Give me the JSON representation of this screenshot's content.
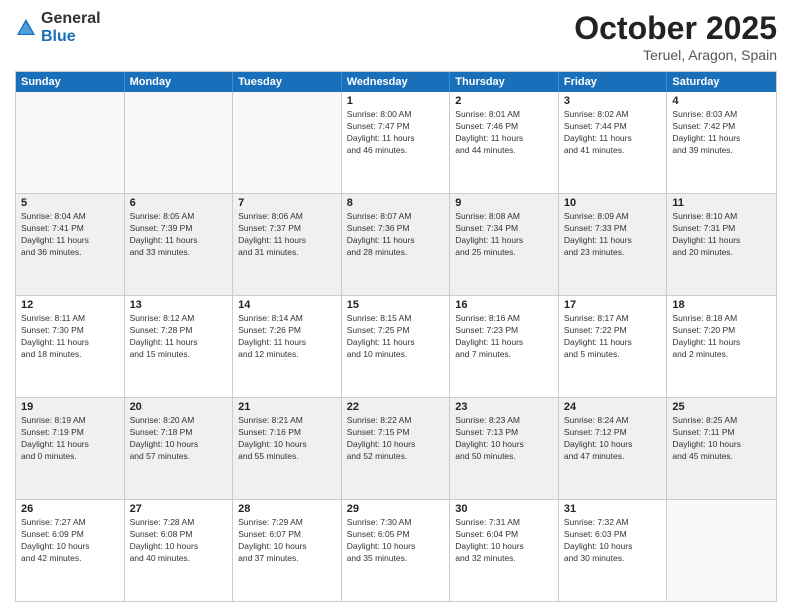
{
  "logo": {
    "general": "General",
    "blue": "Blue"
  },
  "title": "October 2025",
  "location": "Teruel, Aragon, Spain",
  "header_days": [
    "Sunday",
    "Monday",
    "Tuesday",
    "Wednesday",
    "Thursday",
    "Friday",
    "Saturday"
  ],
  "rows": [
    [
      {
        "day": "",
        "lines": []
      },
      {
        "day": "",
        "lines": []
      },
      {
        "day": "",
        "lines": []
      },
      {
        "day": "1",
        "lines": [
          "Sunrise: 8:00 AM",
          "Sunset: 7:47 PM",
          "Daylight: 11 hours",
          "and 46 minutes."
        ]
      },
      {
        "day": "2",
        "lines": [
          "Sunrise: 8:01 AM",
          "Sunset: 7:46 PM",
          "Daylight: 11 hours",
          "and 44 minutes."
        ]
      },
      {
        "day": "3",
        "lines": [
          "Sunrise: 8:02 AM",
          "Sunset: 7:44 PM",
          "Daylight: 11 hours",
          "and 41 minutes."
        ]
      },
      {
        "day": "4",
        "lines": [
          "Sunrise: 8:03 AM",
          "Sunset: 7:42 PM",
          "Daylight: 11 hours",
          "and 39 minutes."
        ]
      }
    ],
    [
      {
        "day": "5",
        "lines": [
          "Sunrise: 8:04 AM",
          "Sunset: 7:41 PM",
          "Daylight: 11 hours",
          "and 36 minutes."
        ]
      },
      {
        "day": "6",
        "lines": [
          "Sunrise: 8:05 AM",
          "Sunset: 7:39 PM",
          "Daylight: 11 hours",
          "and 33 minutes."
        ]
      },
      {
        "day": "7",
        "lines": [
          "Sunrise: 8:06 AM",
          "Sunset: 7:37 PM",
          "Daylight: 11 hours",
          "and 31 minutes."
        ]
      },
      {
        "day": "8",
        "lines": [
          "Sunrise: 8:07 AM",
          "Sunset: 7:36 PM",
          "Daylight: 11 hours",
          "and 28 minutes."
        ]
      },
      {
        "day": "9",
        "lines": [
          "Sunrise: 8:08 AM",
          "Sunset: 7:34 PM",
          "Daylight: 11 hours",
          "and 25 minutes."
        ]
      },
      {
        "day": "10",
        "lines": [
          "Sunrise: 8:09 AM",
          "Sunset: 7:33 PM",
          "Daylight: 11 hours",
          "and 23 minutes."
        ]
      },
      {
        "day": "11",
        "lines": [
          "Sunrise: 8:10 AM",
          "Sunset: 7:31 PM",
          "Daylight: 11 hours",
          "and 20 minutes."
        ]
      }
    ],
    [
      {
        "day": "12",
        "lines": [
          "Sunrise: 8:11 AM",
          "Sunset: 7:30 PM",
          "Daylight: 11 hours",
          "and 18 minutes."
        ]
      },
      {
        "day": "13",
        "lines": [
          "Sunrise: 8:12 AM",
          "Sunset: 7:28 PM",
          "Daylight: 11 hours",
          "and 15 minutes."
        ]
      },
      {
        "day": "14",
        "lines": [
          "Sunrise: 8:14 AM",
          "Sunset: 7:26 PM",
          "Daylight: 11 hours",
          "and 12 minutes."
        ]
      },
      {
        "day": "15",
        "lines": [
          "Sunrise: 8:15 AM",
          "Sunset: 7:25 PM",
          "Daylight: 11 hours",
          "and 10 minutes."
        ]
      },
      {
        "day": "16",
        "lines": [
          "Sunrise: 8:16 AM",
          "Sunset: 7:23 PM",
          "Daylight: 11 hours",
          "and 7 minutes."
        ]
      },
      {
        "day": "17",
        "lines": [
          "Sunrise: 8:17 AM",
          "Sunset: 7:22 PM",
          "Daylight: 11 hours",
          "and 5 minutes."
        ]
      },
      {
        "day": "18",
        "lines": [
          "Sunrise: 8:18 AM",
          "Sunset: 7:20 PM",
          "Daylight: 11 hours",
          "and 2 minutes."
        ]
      }
    ],
    [
      {
        "day": "19",
        "lines": [
          "Sunrise: 8:19 AM",
          "Sunset: 7:19 PM",
          "Daylight: 11 hours",
          "and 0 minutes."
        ]
      },
      {
        "day": "20",
        "lines": [
          "Sunrise: 8:20 AM",
          "Sunset: 7:18 PM",
          "Daylight: 10 hours",
          "and 57 minutes."
        ]
      },
      {
        "day": "21",
        "lines": [
          "Sunrise: 8:21 AM",
          "Sunset: 7:16 PM",
          "Daylight: 10 hours",
          "and 55 minutes."
        ]
      },
      {
        "day": "22",
        "lines": [
          "Sunrise: 8:22 AM",
          "Sunset: 7:15 PM",
          "Daylight: 10 hours",
          "and 52 minutes."
        ]
      },
      {
        "day": "23",
        "lines": [
          "Sunrise: 8:23 AM",
          "Sunset: 7:13 PM",
          "Daylight: 10 hours",
          "and 50 minutes."
        ]
      },
      {
        "day": "24",
        "lines": [
          "Sunrise: 8:24 AM",
          "Sunset: 7:12 PM",
          "Daylight: 10 hours",
          "and 47 minutes."
        ]
      },
      {
        "day": "25",
        "lines": [
          "Sunrise: 8:25 AM",
          "Sunset: 7:11 PM",
          "Daylight: 10 hours",
          "and 45 minutes."
        ]
      }
    ],
    [
      {
        "day": "26",
        "lines": [
          "Sunrise: 7:27 AM",
          "Sunset: 6:09 PM",
          "Daylight: 10 hours",
          "and 42 minutes."
        ]
      },
      {
        "day": "27",
        "lines": [
          "Sunrise: 7:28 AM",
          "Sunset: 6:08 PM",
          "Daylight: 10 hours",
          "and 40 minutes."
        ]
      },
      {
        "day": "28",
        "lines": [
          "Sunrise: 7:29 AM",
          "Sunset: 6:07 PM",
          "Daylight: 10 hours",
          "and 37 minutes."
        ]
      },
      {
        "day": "29",
        "lines": [
          "Sunrise: 7:30 AM",
          "Sunset: 6:05 PM",
          "Daylight: 10 hours",
          "and 35 minutes."
        ]
      },
      {
        "day": "30",
        "lines": [
          "Sunrise: 7:31 AM",
          "Sunset: 6:04 PM",
          "Daylight: 10 hours",
          "and 32 minutes."
        ]
      },
      {
        "day": "31",
        "lines": [
          "Sunrise: 7:32 AM",
          "Sunset: 6:03 PM",
          "Daylight: 10 hours",
          "and 30 minutes."
        ]
      },
      {
        "day": "",
        "lines": []
      }
    ]
  ]
}
